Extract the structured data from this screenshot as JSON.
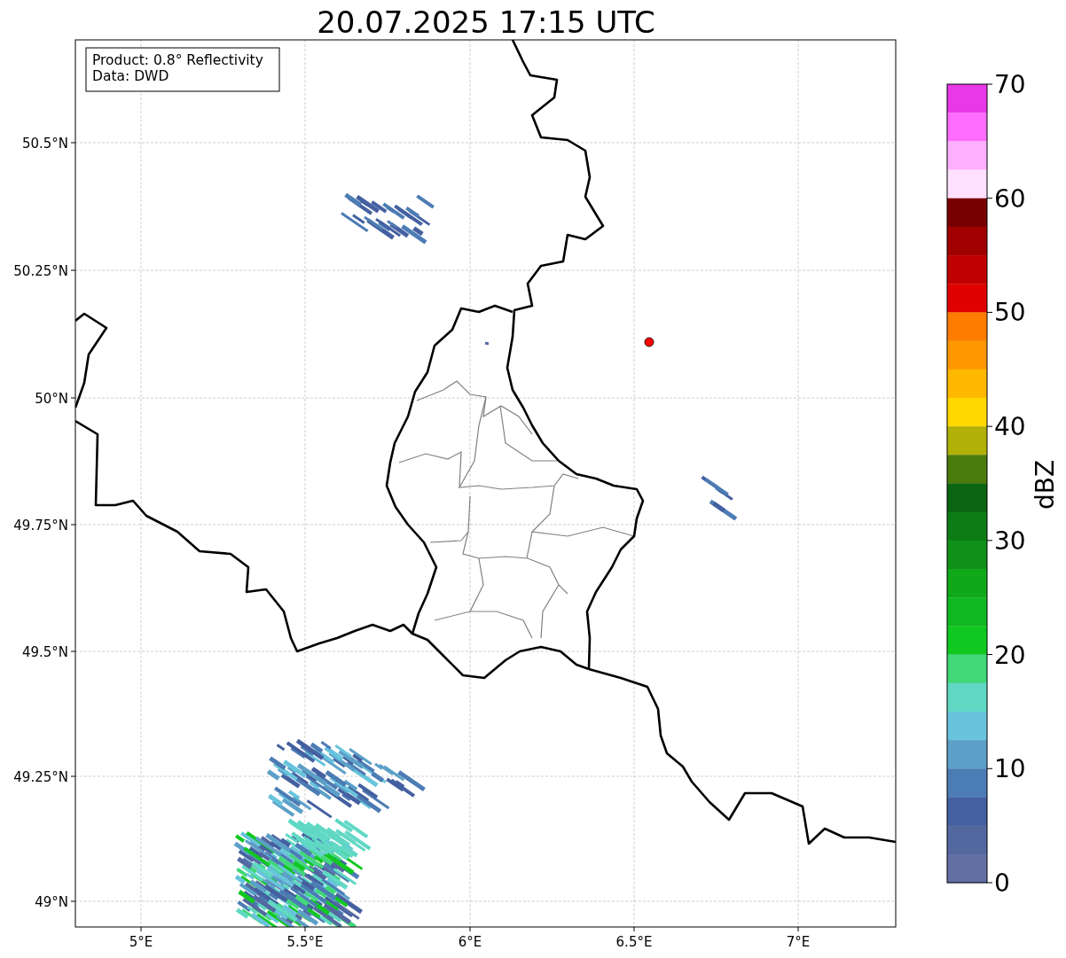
{
  "title": "20.07.2025 17:15 UTC",
  "info_box": [
    "Product: 0.8° Reflectivity",
    "Data: DWD"
  ],
  "map": {
    "lat_ticks": [
      "50.5°N",
      "50.25°N",
      "50°N",
      "49.75°N",
      "49.5°N",
      "49.25°N",
      "49°N"
    ],
    "lon_ticks": [
      "5°E",
      "5.5°E",
      "6°E",
      "6.5°E",
      "7°E"
    ]
  },
  "colorbar": {
    "label": "dBZ",
    "ticks": [
      "70",
      "60",
      "50",
      "40",
      "30",
      "20",
      "10",
      "0"
    ],
    "bins": [
      {
        "color": "#e838e8"
      },
      {
        "color": "#ff6cff"
      },
      {
        "color": "#ffb0ff"
      },
      {
        "color": "#ffe0ff"
      },
      {
        "color": "#780000"
      },
      {
        "color": "#a00000"
      },
      {
        "color": "#c00000"
      },
      {
        "color": "#e00000"
      },
      {
        "color": "#ff7c00"
      },
      {
        "color": "#ff9800"
      },
      {
        "color": "#ffb800"
      },
      {
        "color": "#ffd800"
      },
      {
        "color": "#b0b008"
      },
      {
        "color": "#4a7c0c"
      },
      {
        "color": "#0a6410"
      },
      {
        "color": "#0c7c14"
      },
      {
        "color": "#109018"
      },
      {
        "color": "#10a818"
      },
      {
        "color": "#10b820"
      },
      {
        "color": "#10c820"
      },
      {
        "color": "#40d878"
      },
      {
        "color": "#60d8c4"
      },
      {
        "color": "#68c4dc"
      },
      {
        "color": "#5ca0c8"
      },
      {
        "color": "#4c7cb4"
      },
      {
        "color": "#4460a0"
      },
      {
        "color": "#5468a0"
      },
      {
        "color": "#6470a4"
      }
    ]
  }
}
